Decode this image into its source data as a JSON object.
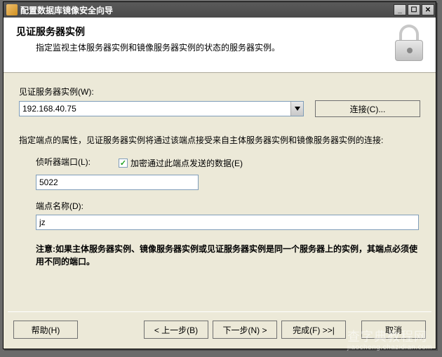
{
  "window": {
    "title": "配置数据库镜像安全向导"
  },
  "header": {
    "title": "见证服务器实例",
    "subtitle": "指定监视主体服务器实例和镜像服务器实例的状态的服务器实例。"
  },
  "witness": {
    "label": "见证服务器实例(W):",
    "value": "192.168.40.75",
    "connect_label": "连接(C)..."
  },
  "endpoint": {
    "description": "指定端点的属性，见证服务器实例将通过该端点接受来自主体服务器实例和镜像服务器实例的连接:",
    "port_label": "侦听器端口(L):",
    "port_value": "5022",
    "encrypt_label": "加密通过此端点发送的数据(E)",
    "encrypt_checked": true,
    "name_label": "端点名称(D):",
    "name_value": "jz"
  },
  "note": "注意:如果主体服务器实例、镜像服务器实例或见证服务器实例是同一个服务器上的实例，其端点必须使用不同的端口。",
  "buttons": {
    "help": "帮助(H)",
    "back": "< 上一步(B)",
    "next": "下一步(N) >",
    "finish": "完成(F) >>|",
    "cancel": "取消"
  },
  "watermark": {
    "main": "查字典教程网",
    "sub": "jiaocheng.chazidian.com"
  }
}
